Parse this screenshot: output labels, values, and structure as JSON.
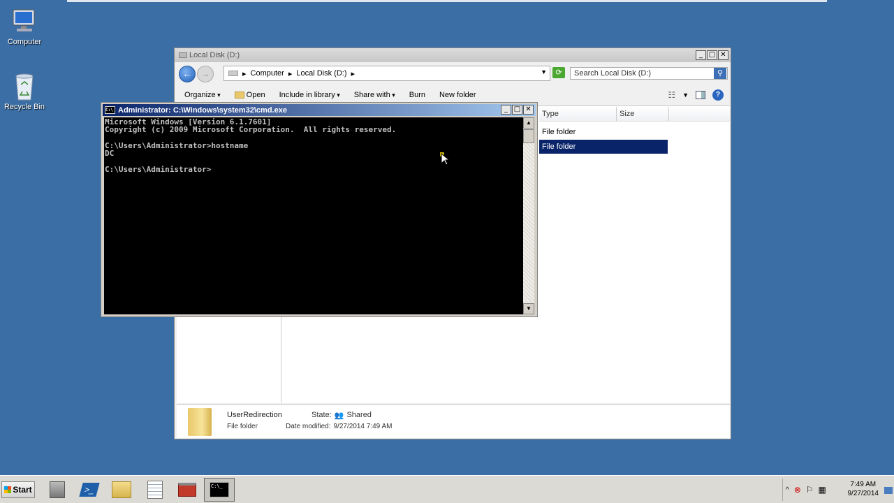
{
  "desktop": {
    "icons": [
      {
        "label": "Computer",
        "icon": "computer-icon"
      },
      {
        "label": "Recycle Bin",
        "icon": "recycle-bin-icon"
      }
    ]
  },
  "explorer": {
    "title": "Local Disk (D:)",
    "address": {
      "crumbs": [
        "Computer",
        "Local Disk (D:)"
      ]
    },
    "search_placeholder": "Search Local Disk (D:)",
    "toolbar": {
      "organize": "Organize",
      "open": "Open",
      "include_in_library": "Include in library",
      "share_with": "Share with",
      "burn": "Burn",
      "new_folder": "New folder"
    },
    "columns": {
      "type": "Type",
      "size": "Size"
    },
    "rows": [
      {
        "type": "File folder",
        "selected": false
      },
      {
        "type": "File folder",
        "selected": true
      }
    ],
    "details": {
      "name": "UserRedirection",
      "kind": "File folder",
      "state_label": "State:",
      "state_value": "Shared",
      "date_label": "Date modified:",
      "date_value": "9/27/2014 7:49 AM"
    }
  },
  "cmd": {
    "title": "Administrator: C:\\Windows\\system32\\cmd.exe",
    "lines": [
      "Microsoft Windows [Version 6.1.7601]",
      "Copyright (c) 2009 Microsoft Corporation.  All rights reserved.",
      "",
      "C:\\Users\\Administrator>hostname",
      "DC",
      "",
      "C:\\Users\\Administrator>"
    ]
  },
  "taskbar": {
    "start_label": "Start",
    "buttons": [
      "server-manager-icon",
      "powershell-icon",
      "explorer-folder-icon",
      "notepad-icon",
      "toolbox-icon",
      "cmd-icon"
    ],
    "clock": {
      "time": "7:49 AM",
      "date": "9/27/2014"
    }
  },
  "colors": {
    "desktop": "#3a6ea5",
    "selection": "#0a246a",
    "console_bg": "#000000"
  }
}
